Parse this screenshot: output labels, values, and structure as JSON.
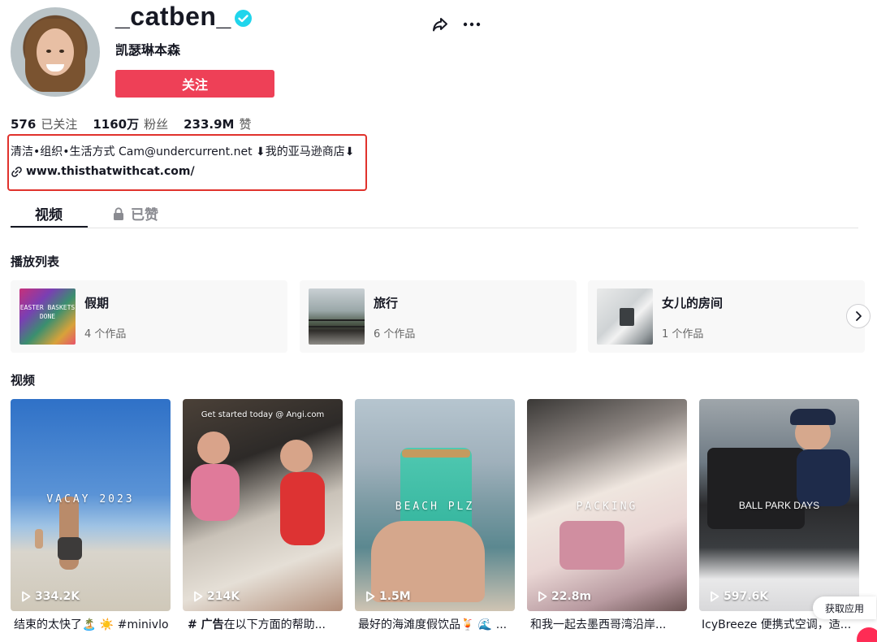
{
  "profile": {
    "username": "_catben_",
    "nickname": "凯瑟琳本森",
    "follow_label": "关注"
  },
  "stats": {
    "following_count": "576",
    "following_label": "已关注",
    "followers_count": "1160万",
    "followers_label": "粉丝",
    "likes_count": "233.9M",
    "likes_label": "赞"
  },
  "bio": {
    "text": "清洁•组织•生活方式 Cam@undercurrent.net ⬇︎我的亚马逊商店⬇︎",
    "link": "www.thisthatwithcat.com/"
  },
  "tabs": {
    "videos": "视频",
    "liked": "已赞"
  },
  "sections": {
    "playlists": "播放列表",
    "videos": "视频"
  },
  "playlists": [
    {
      "name": "假期",
      "count": "4 个作品",
      "thumb_text": "EASTER BASKETS DONE"
    },
    {
      "name": "旅行",
      "count": "6 个作品"
    },
    {
      "name": "女儿的房间",
      "count": "1 个作品"
    }
  ],
  "videos": [
    {
      "views": "334.2K",
      "overlay": "VACAY 2023",
      "desc": "结束的太快了🏝️ ☀️ #minivlog"
    },
    {
      "views": "214K",
      "overlay": "Get started today @ Angi.com",
      "desc_tag": "# 广告",
      "desc": "在以下方面的帮助..."
    },
    {
      "views": "1.5M",
      "overlay": "BEACH PLZ",
      "desc": "最好的海滩度假饮品🍹 🌊 ..."
    },
    {
      "views": "22.8m",
      "overlay": "PACKING",
      "desc": "和我一起去墨西哥湾沿岸..."
    },
    {
      "views": "597.6K",
      "overlay": "BALL PARK DAYS",
      "desc": "IcyBreeze 便携式空调，适..."
    }
  ],
  "get_app_label": "获取应用",
  "colors": {
    "follow_button": "#ee4057",
    "verified_badge": "#20d5ec",
    "highlight_border": "#e0322c"
  }
}
